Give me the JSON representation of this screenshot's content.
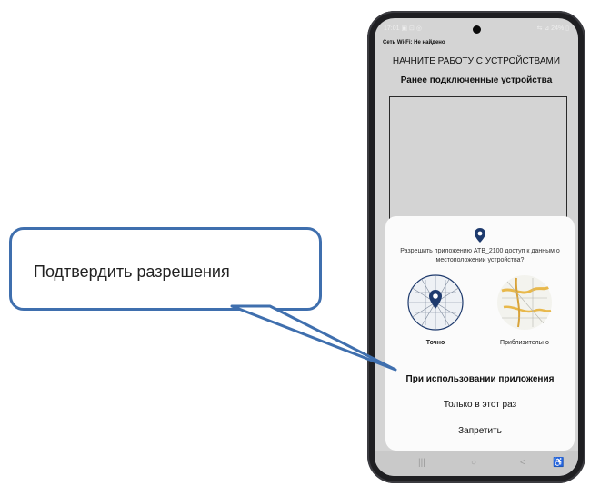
{
  "callout": {
    "text": "Подтвердить разрешения"
  },
  "phone": {
    "status_time": "17:01 ▣ ⊡ ◎",
    "status_right": "⇆ ⊿ 24% ▯",
    "wifi_note": "Сеть Wi-Fi: Не найдено",
    "app_title": "НАЧНИТЕ РАБОТУ С УСТРОЙСТВАМИ",
    "app_subtitle": "Ранее подключенные устройства",
    "nav": {
      "recent": "|||",
      "home": "○",
      "back": "<",
      "accessibility": "♿"
    }
  },
  "permission": {
    "text": "Разрешить приложению ATB_2100 доступ к данным о местоположении устройства?",
    "options": {
      "precise_label": "Точно",
      "approx_label": "Приблизительно"
    },
    "choices": [
      {
        "label": "При использовании приложения"
      },
      {
        "label": "Только в этот раз"
      },
      {
        "label": "Запретить"
      }
    ]
  },
  "colors": {
    "accent": "#3f6fae",
    "pin": "#1e3a6d",
    "sheet": "#fbfbfb",
    "screen_bg": "#d4d4d4"
  },
  "icons": {
    "location": "pin-icon",
    "precise_map": "precise-map-icon",
    "approximate_map": "approximate-map-icon"
  }
}
